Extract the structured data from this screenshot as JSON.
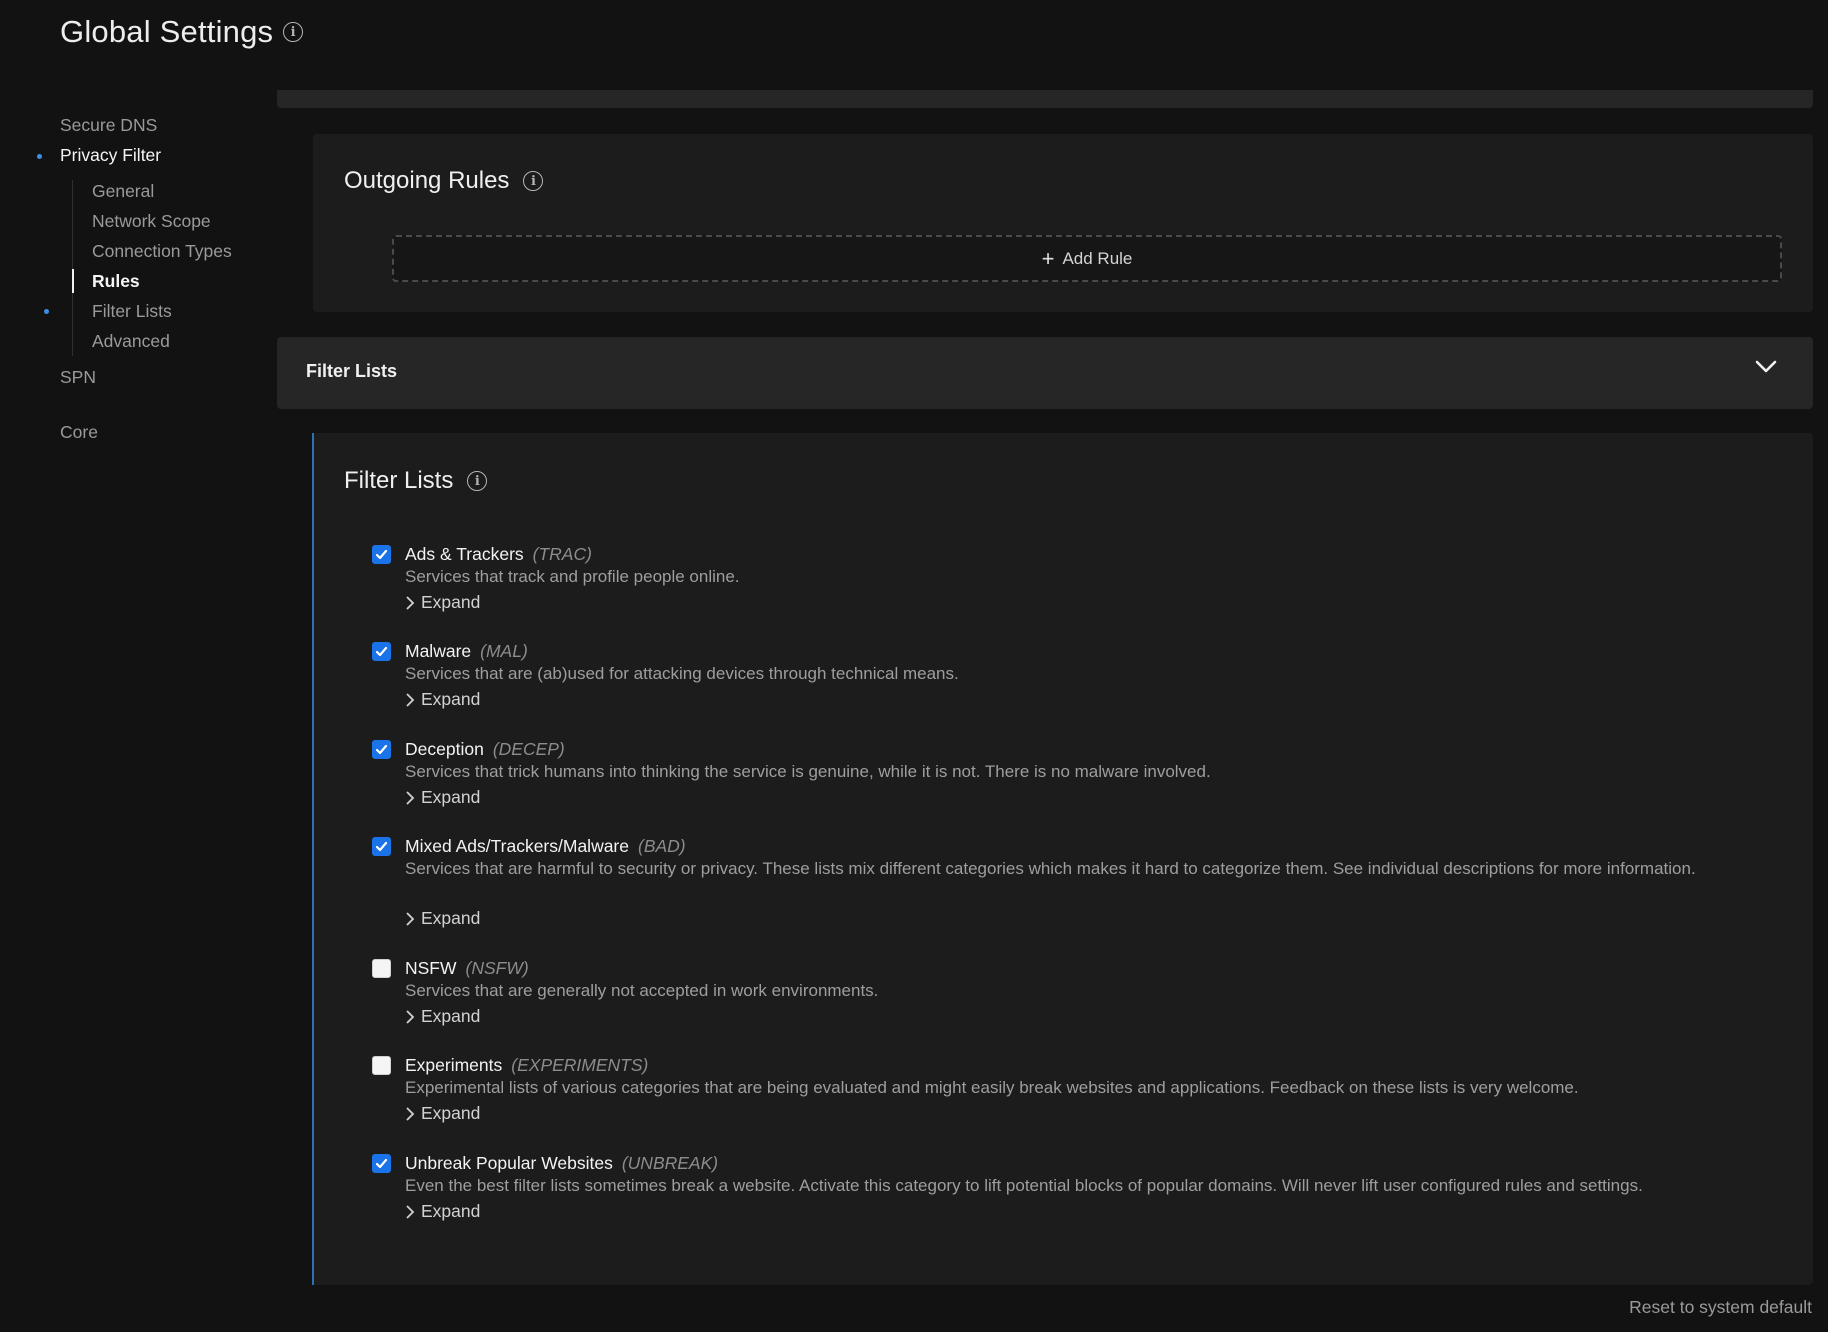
{
  "header": {
    "title": "Global Settings",
    "info_icon": "info-icon"
  },
  "sidebar": {
    "items": [
      {
        "label": "Secure DNS"
      },
      {
        "label": "Privacy Filter"
      },
      {
        "label": "SPN"
      },
      {
        "label": "Core"
      }
    ],
    "sub_items": [
      {
        "label": "General"
      },
      {
        "label": "Network Scope"
      },
      {
        "label": "Connection Types"
      },
      {
        "label": "Rules"
      },
      {
        "label": "Filter Lists"
      },
      {
        "label": "Advanced"
      }
    ],
    "accent_color": "#3f8ee6"
  },
  "outgoing_rules": {
    "title": "Outgoing Rules",
    "add_rule_label": "Add Rule"
  },
  "accordion": {
    "label": "Filter Lists"
  },
  "filter_lists": {
    "title": "Filter Lists",
    "expand_label": "Expand",
    "items": [
      {
        "name": "Ads & Trackers",
        "code": "(TRAC)",
        "checked": true,
        "desc": "Services that track and profile people online."
      },
      {
        "name": "Malware",
        "code": "(MAL)",
        "checked": true,
        "desc": "Services that are (ab)used for attacking devices through technical means."
      },
      {
        "name": "Deception",
        "code": "(DECEP)",
        "checked": true,
        "desc": "Services that trick humans into thinking the service is genuine, while it is not. There is no malware involved."
      },
      {
        "name": "Mixed Ads/Trackers/Malware",
        "code": "(BAD)",
        "checked": true,
        "desc": "Services that are harmful to security or privacy. These lists mix different categories which makes it hard to categorize them. See individual descriptions for more information."
      },
      {
        "name": "NSFW",
        "code": "(NSFW)",
        "checked": false,
        "desc": "Services that are generally not accepted in work environments."
      },
      {
        "name": "Experiments",
        "code": "(EXPERIMENTS)",
        "checked": false,
        "desc": "Experimental lists of various categories that are being evaluated and might easily break websites and applications. Feedback on these lists is very welcome."
      },
      {
        "name": "Unbreak Popular Websites",
        "code": "(UNBREAK)",
        "checked": true,
        "desc": "Even the best filter lists sometimes break a website. Activate this category to lift potential blocks of popular domains. Will never lift user configured rules and settings."
      }
    ]
  },
  "footer": {
    "reset_label": "Reset to system default"
  },
  "colors": {
    "checkbox_checked": "#1a73e8",
    "section_border": "#2e6fb5"
  }
}
